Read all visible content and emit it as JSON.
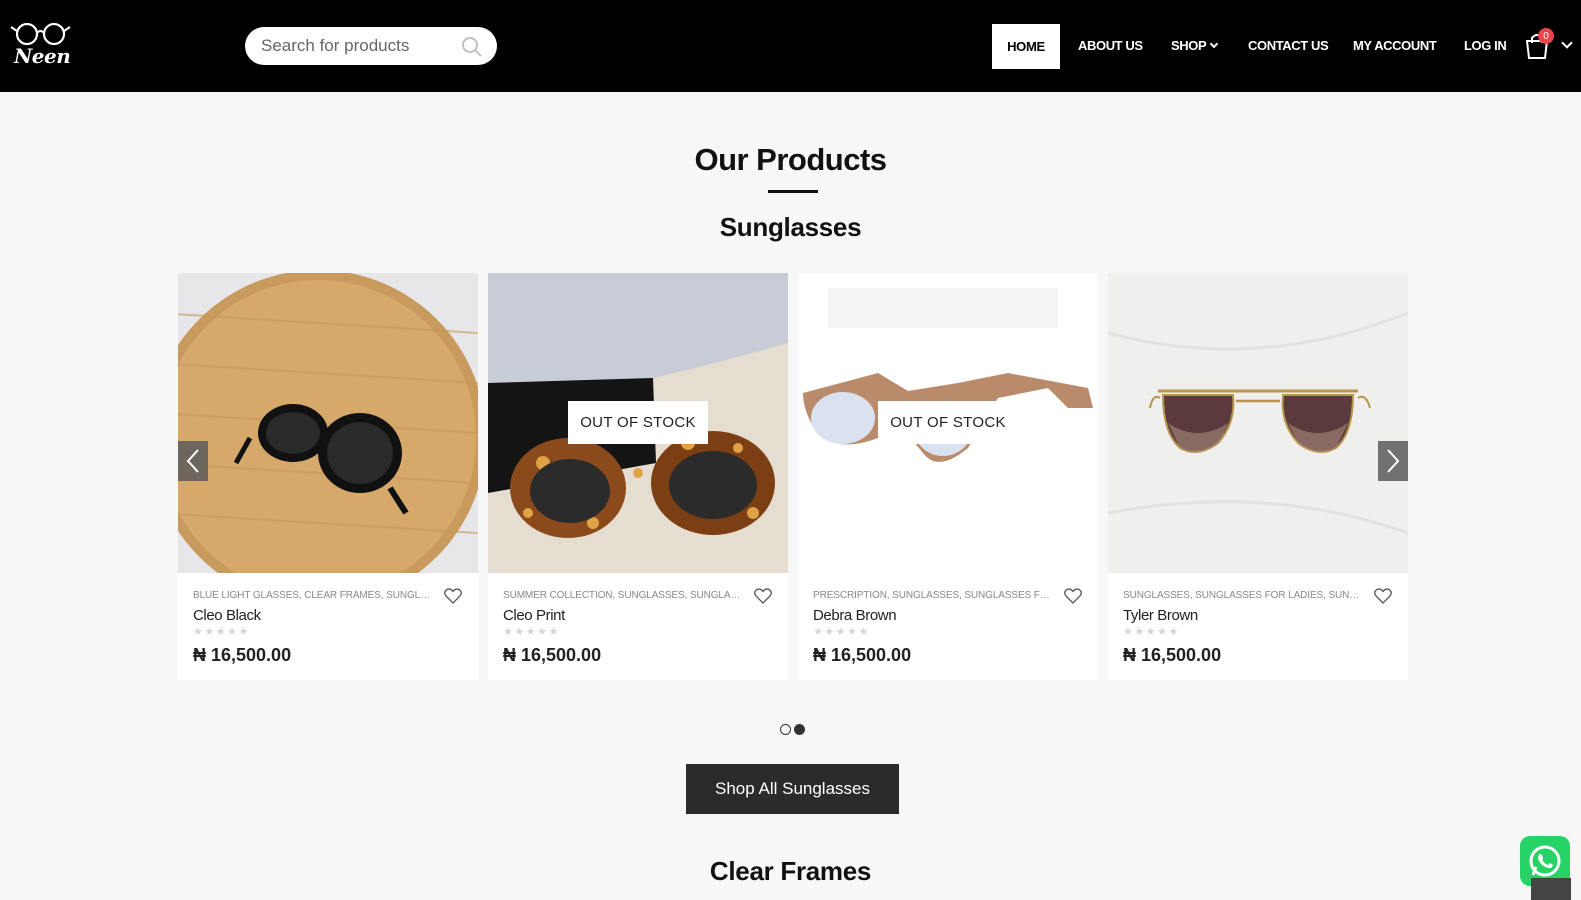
{
  "header": {
    "logo_text": "Neen",
    "search": {
      "placeholder": "Search for products"
    },
    "nav": {
      "home": "HOME",
      "about": "ABOUT US",
      "shop": "SHOP",
      "contact": "CONTACT US",
      "account": "MY ACCOUNT",
      "login": "LOG IN"
    },
    "cart_count": "0"
  },
  "main": {
    "title": "Our Products",
    "section1": "Sunglasses",
    "section2": "Clear Frames",
    "shop_all_label": "Shop All Sunglasses",
    "products": [
      {
        "categories": "BLUE LIGHT GLASSES, CLEAR FRAMES, SUNGLASSES",
        "name": "Cleo Black",
        "stars": "★★★★★",
        "price": "₦ 16,500.00",
        "out_of_stock": ""
      },
      {
        "categories": "SUMMER COLLECTION, SUNGLASSES, SUNGLASSES FOR LADIES",
        "name": "Cleo Print",
        "stars": "★★★★★",
        "price": "₦ 16,500.00",
        "out_of_stock": "OUT OF STOCK"
      },
      {
        "categories": "PRESCRIPTION, SUNGLASSES, SUNGLASSES FOR LADIES",
        "name": "Debra Brown",
        "stars": "★★★★★",
        "price": "₦ 16,500.00",
        "out_of_stock": "OUT OF STOCK"
      },
      {
        "categories": "SUNGLASSES, SUNGLASSES FOR LADIES, SUNGLASSES FOR MEN",
        "name": "Tyler Brown",
        "stars": "★★★★★",
        "price": "₦ 16,500.00",
        "out_of_stock": ""
      }
    ],
    "carousel_pages": 2,
    "carousel_active": 2
  },
  "colors": {
    "header_bg": "#000000",
    "page_bg": "#f7f7f7",
    "button_bg": "#2b2b2b",
    "badge": "#e8454a",
    "whatsapp": "#25d366"
  }
}
